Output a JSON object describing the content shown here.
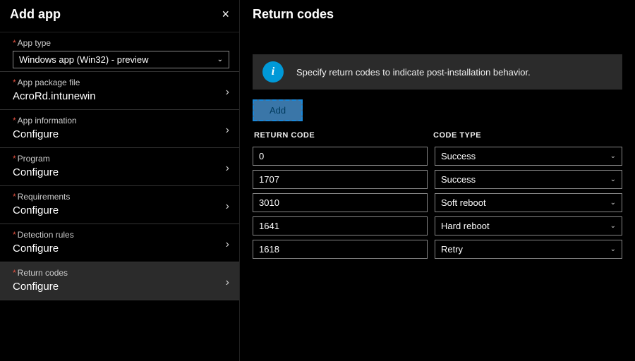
{
  "leftPanel": {
    "title": "Add app",
    "closeIcon": "×",
    "fields": [
      {
        "label": "App type",
        "value": "Windows app (Win32) - preview",
        "kind": "dropdown",
        "required": true
      },
      {
        "label": "App package file",
        "value": "AcroRd.intunewin",
        "kind": "nav",
        "required": true
      },
      {
        "label": "App information",
        "value": "Configure",
        "kind": "nav",
        "required": true
      },
      {
        "label": "Program",
        "value": "Configure",
        "kind": "nav",
        "required": true
      },
      {
        "label": "Requirements",
        "value": "Configure",
        "kind": "nav",
        "required": true
      },
      {
        "label": "Detection rules",
        "value": "Configure",
        "kind": "nav",
        "required": true
      },
      {
        "label": "Return codes",
        "value": "Configure",
        "kind": "nav",
        "required": true,
        "selected": true
      }
    ]
  },
  "rightPanel": {
    "title": "Return codes",
    "infoText": "Specify return codes to indicate post-installation behavior.",
    "addButton": "Add",
    "colCode": "RETURN CODE",
    "colType": "CODE TYPE",
    "rows": [
      {
        "code": "0",
        "type": "Success"
      },
      {
        "code": "1707",
        "type": "Success"
      },
      {
        "code": "3010",
        "type": "Soft reboot"
      },
      {
        "code": "1641",
        "type": "Hard reboot"
      },
      {
        "code": "1618",
        "type": "Retry"
      }
    ]
  }
}
